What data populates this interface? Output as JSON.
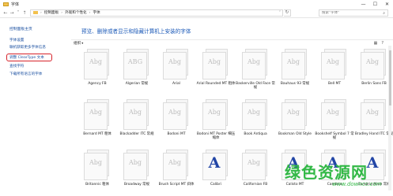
{
  "window": {
    "title": "字体",
    "controls": [
      "—",
      "☐",
      "✕"
    ]
  },
  "address": {
    "crumbs": [
      "控制面板",
      "外观和个性化",
      "字体"
    ],
    "separator": "›",
    "search_placeholder": "搜索\"字体\""
  },
  "left_pane": {
    "home": "控制面板主页",
    "links": [
      "字体设置",
      "联机获取更多字体信息",
      "调整 ClearType 文本",
      "查找字符",
      "下载所有语言的字体"
    ],
    "highlighted_index": 2,
    "highlight_color": "#d6222a"
  },
  "main": {
    "heading": "预览、删除或者显示和隐藏计算机上安装的字体",
    "heading_color": "#1e5bb8",
    "toolbar": {
      "organize": "组织",
      "organize_caret": "▾"
    },
    "fonts": [
      {
        "name": "Agency FB",
        "sample": "Abg",
        "style": "ghost"
      },
      {
        "name": "Algerian 常规",
        "sample": "ABG",
        "style": "ghost"
      },
      {
        "name": "Arial",
        "sample": "Abg",
        "style": "ghost"
      },
      {
        "name": "Arial Rounded MT 粗体",
        "sample": "Abg",
        "style": "ghost"
      },
      {
        "name": "Baskerville Old Face 常规",
        "sample": "Abg",
        "style": "ghost"
      },
      {
        "name": "Bauhaus 93 常规",
        "sample": "Abg",
        "style": "ghost"
      },
      {
        "name": "Bell MT",
        "sample": "Abg",
        "style": "ghost"
      },
      {
        "name": "Berlin Sans FB",
        "sample": "Abg",
        "style": "ghost"
      },
      {
        "name": "Bernard MT 粗体",
        "sample": "Abg",
        "style": "ghost"
      },
      {
        "name": "Blackadder ITC 常规",
        "sample": "Abg",
        "style": "ghost"
      },
      {
        "name": "Bodoni MT",
        "sample": "Abg",
        "style": "ghost"
      },
      {
        "name": "Bodoni MT Poster 细压缩体",
        "sample": "Abg",
        "style": "ghost"
      },
      {
        "name": "Book Antiqua",
        "sample": "Abg",
        "style": "ghost"
      },
      {
        "name": "Bookman Old Style",
        "sample": "Abg",
        "style": "ghost"
      },
      {
        "name": "Bookshelf Symbol 7 常规",
        "sample": "Abg",
        "style": "ghost"
      },
      {
        "name": "Bradley Hand ITC 常规",
        "sample": "Abg",
        "style": "ghost"
      },
      {
        "name": "Britannic 粗体",
        "sample": "Abg",
        "style": "ghost"
      },
      {
        "name": "Broadway 常规",
        "sample": "Abg",
        "style": "ghost"
      },
      {
        "name": "Brush Script MT 斜体",
        "sample": "Abg",
        "style": "ghost"
      },
      {
        "name": "Calibri",
        "sample": "A",
        "style": "bigA"
      },
      {
        "name": "Californian FB",
        "sample": "Abg",
        "style": "ghost"
      },
      {
        "name": "Calisto MT",
        "sample": "A",
        "style": "bigA"
      },
      {
        "name": "Cambria",
        "sample": "A",
        "style": "bigA"
      },
      {
        "name": "Cambria Math 常规",
        "sample": "A",
        "style": "bigA"
      }
    ]
  },
  "watermark": {
    "text": "绿色资源网",
    "url": "www.downcc.com",
    "color": "#32b846"
  }
}
